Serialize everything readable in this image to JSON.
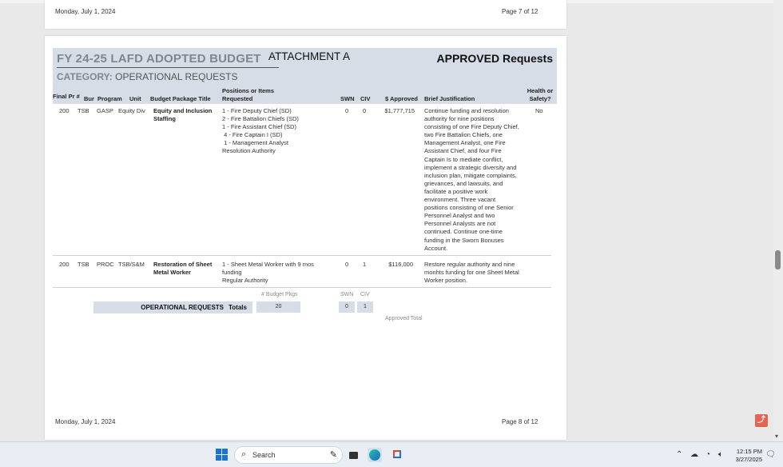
{
  "viewer": {
    "scrollbar_down_glyph": "▾",
    "pdf_tool_icon": "pdf-icon"
  },
  "page_prev": {
    "date": "Monday, July 1, 2024",
    "page": "Page 7 of 12"
  },
  "page_curr": {
    "title": "FY 24-25 LAFD ADOPTED BUDGET",
    "attachment": "ATTACHMENT A",
    "approved_title": "APPROVED Requests",
    "category_label": "CATEGORY:",
    "category_value": "OPERATIONAL REQUESTS",
    "columns": {
      "final_pr": "Final Pr #",
      "bur": "Bur",
      "program": "Program",
      "unit": "Unit",
      "pkg_title": "Budget Package Title",
      "positions": "Positions or Items Requested",
      "swn": "SWN",
      "civ": "CIV",
      "approved": "$ Approved",
      "justification": "Brief Justification",
      "health": "Health or Safety?"
    },
    "rows": [
      {
        "final_pr": "200",
        "bur": "TSB",
        "program": "GASP",
        "unit": "Equity Div",
        "pkg_title": "Equity and Inclusion Staffing",
        "positions": [
          "1 - Fire Deputy Chief (SD)",
          "2 - Fire Battalion Chiefs (SD)",
          "1 - Fire Assistant Chief (SD)",
          " 4 - Fire Captain I (SD)",
          " 1 - Management Analyst",
          "Resolution Authority"
        ],
        "swn": "0",
        "civ": "0",
        "approved": "$1,777,715",
        "justification": [
          "Continue funding and resolution",
          "authority for nine positions",
          "consisting of one Fire Deputy Chief,",
          "two Fire Battalion Chiefs, one",
          "Management Analyst, one Fire",
          "Assistant Chief, and four Fire",
          "Captain Is to mediate conflict,",
          "implement a strategic diversity and",
          "inclusion plan, mitigate complaints,",
          "grievances, and lawsuits, and",
          "facilitate a positive work",
          "environment.  Three vacant",
          "positions consisting of one Senior",
          "Personnel Analyst and two",
          "Personnel Analysts are not",
          "continued.  Continue one-time",
          "funding in the Sworn Bonuses",
          "Account."
        ],
        "health": "No"
      },
      {
        "final_pr": "200",
        "bur": "TSB",
        "program": "PROC",
        "unit": "TSB/S&M",
        "pkg_title": "Restoration of Sheet Metal Worker",
        "positions": [
          "1 - Sheet Metal Worker with 9 mos",
          "funding",
          "Regular Authority"
        ],
        "swn": "0",
        "civ": "1",
        "approved": "$116,000",
        "justification": [
          "Restore regular authority and nine",
          "monhts funding for one Sheet Metal",
          "Worker position."
        ],
        "health": ""
      }
    ],
    "totals": {
      "label": "OPERATIONAL REQUESTS",
      "word": "Totals",
      "pkgs_header": "# Budget Pkgs",
      "pkgs_value": "20",
      "swn_header": "SWN",
      "swn_value": "0",
      "civ_header": "CIV",
      "civ_value": "1",
      "approved_total_label": "Approved Total"
    },
    "date": "Monday, July 1, 2024",
    "page": "Page 8 of 12"
  },
  "taskbar": {
    "search_placeholder": "Search",
    "time": "12:15 PM",
    "date": "3/27/2025"
  }
}
